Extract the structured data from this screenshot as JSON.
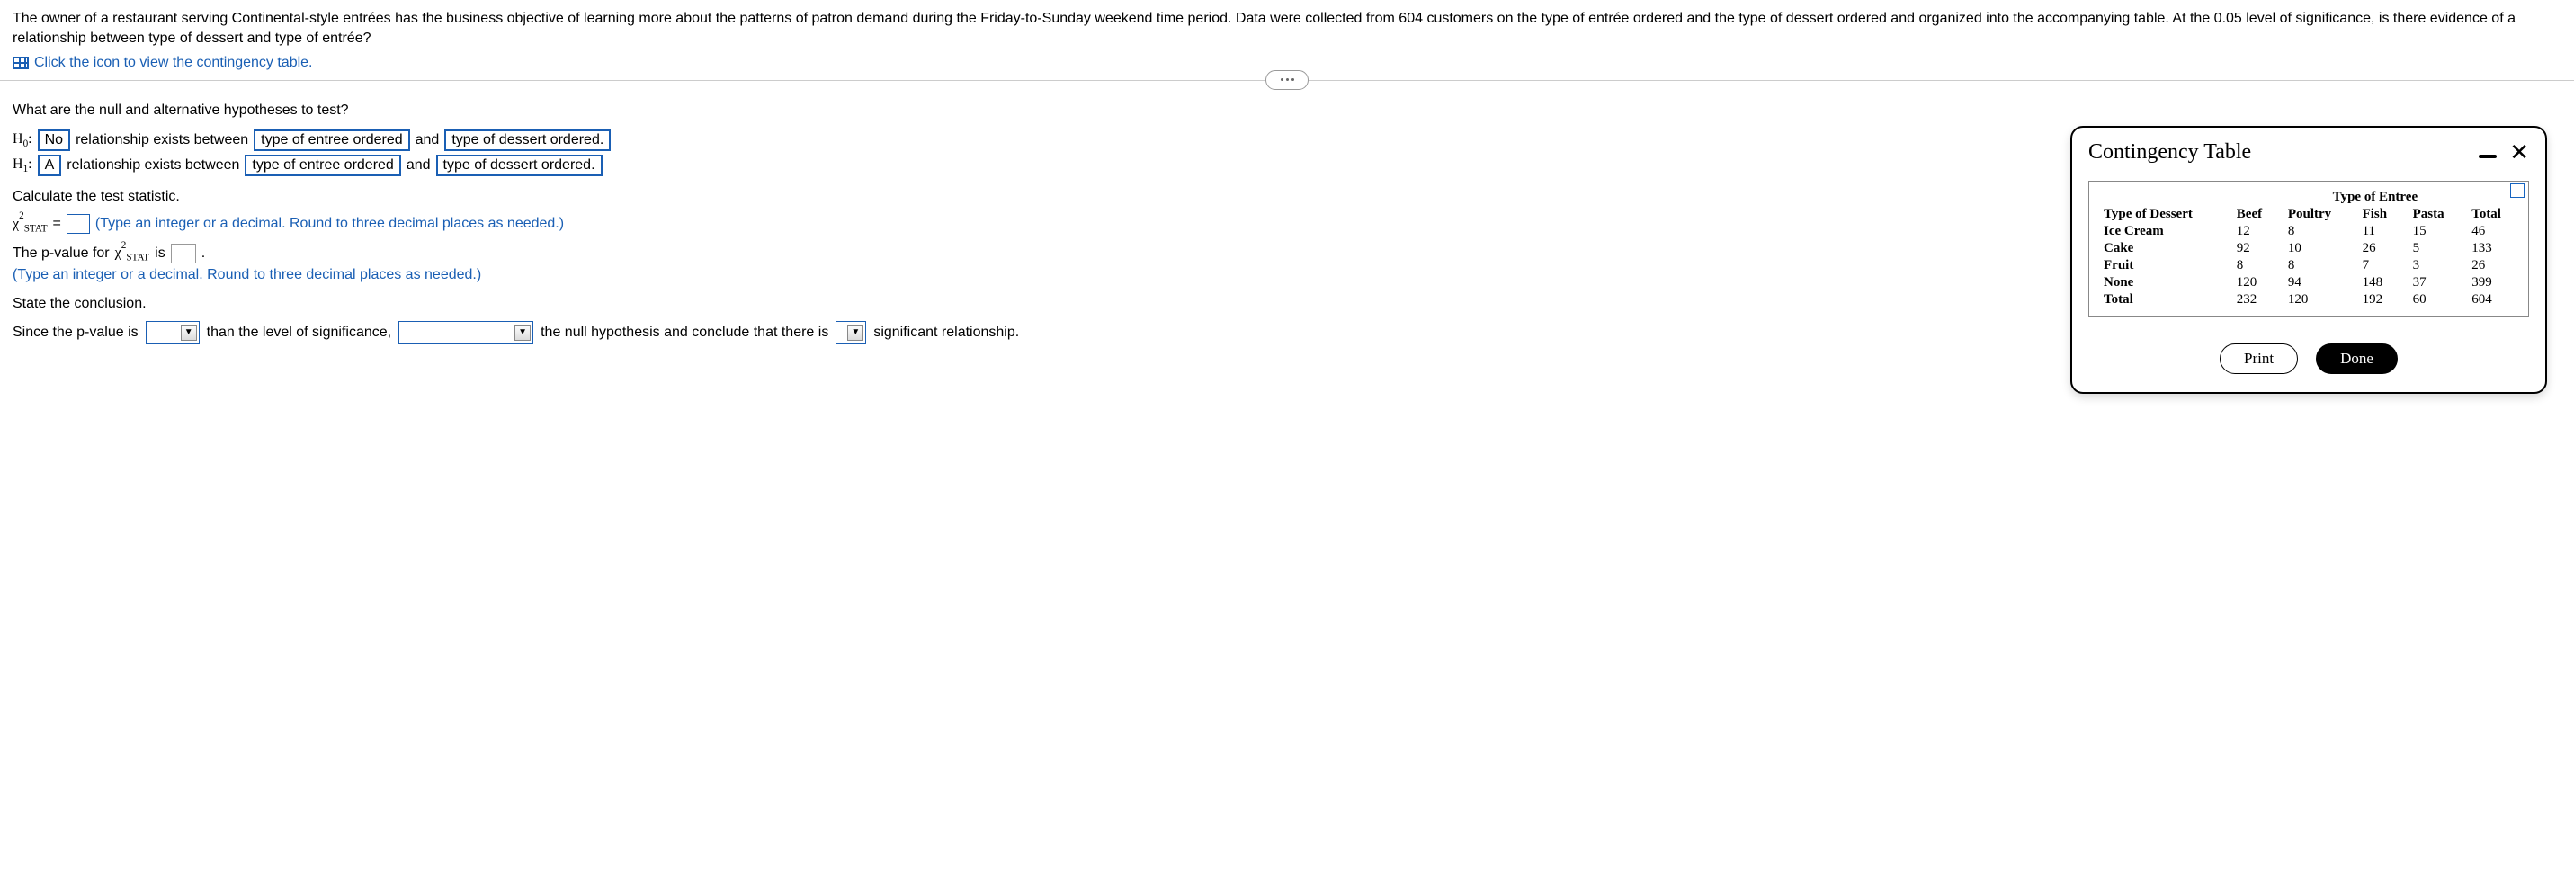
{
  "question": {
    "text": "The owner of a restaurant serving Continental-style entrées has the business objective of learning more about the patterns of patron demand during the Friday-to-Sunday weekend time period. Data were collected from 604 customers on the type of entrée ordered and the type of dessert ordered and organized into the accompanying table. At the 0.05 level of significance, is there evidence of a relationship between type of dessert and type of entrée?",
    "link_text": "Click the icon to view the contingency table."
  },
  "prompts": {
    "hypotheses_q": "What are the null and alternative hypotheses to test?",
    "h0_label": "H₀:",
    "h1_label": "H₁:",
    "h0_ans1": "No",
    "relationship_text": "relationship exists between",
    "var1": "type of entree ordered",
    "and": "and",
    "var2": "type of dessert ordered.",
    "h1_ans1": "A",
    "calc_stat": "Calculate the test statistic.",
    "chi_label_html": "χ",
    "stat_sup": "2",
    "stat_sub": "STAT",
    "equals": " = ",
    "stat_hint": "(Type an integer or a decimal. Round to three decimal places as needed.)",
    "pvalue_pre": "The p-value for ",
    "pvalue_post": " is ",
    "pvalue_hint": "(Type an integer or a decimal. Round to three decimal places as needed.)",
    "state_conclusion": "State the conclusion.",
    "concl_1": "Since the p-value is",
    "concl_2": "than the level of significance,",
    "concl_3": "the null hypothesis and conclude that there is",
    "concl_4": "significant relationship."
  },
  "modal": {
    "title": "Contingency Table",
    "col_group": "Type of Entree",
    "row_group": "Type of Dessert",
    "cols": [
      "Beef",
      "Poultry",
      "Fish",
      "Pasta",
      "Total"
    ],
    "rows": [
      {
        "label": "Ice Cream",
        "vals": [
          "12",
          "8",
          "11",
          "15",
          "46"
        ]
      },
      {
        "label": "Cake",
        "vals": [
          "92",
          "10",
          "26",
          "5",
          "133"
        ]
      },
      {
        "label": "Fruit",
        "vals": [
          "8",
          "8",
          "7",
          "3",
          "26"
        ]
      },
      {
        "label": "None",
        "vals": [
          "120",
          "94",
          "148",
          "37",
          "399"
        ]
      },
      {
        "label": "Total",
        "vals": [
          "232",
          "120",
          "192",
          "60",
          "604"
        ]
      }
    ],
    "print": "Print",
    "done": "Done"
  }
}
